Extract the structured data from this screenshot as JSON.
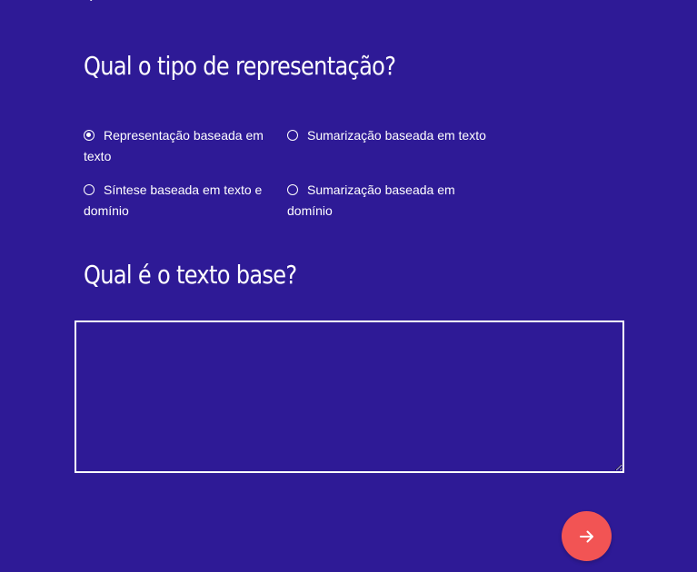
{
  "form": {
    "question_1": "Qual o tipo de representação?",
    "options": [
      {
        "label": "Representação baseada em texto",
        "checked": true
      },
      {
        "label": "Sumarização baseada em texto",
        "checked": false
      },
      {
        "label": "Síntese baseada em texto e domínio",
        "checked": false
      },
      {
        "label": "Sumarização baseada em domínio",
        "checked": false
      }
    ],
    "question_2": "Qual é o texto base?",
    "text_value": "",
    "submit_icon": "arrow-right-icon"
  },
  "colors": {
    "background": "#2e1a96",
    "accent": "#f25454",
    "text": "#ffffff"
  }
}
